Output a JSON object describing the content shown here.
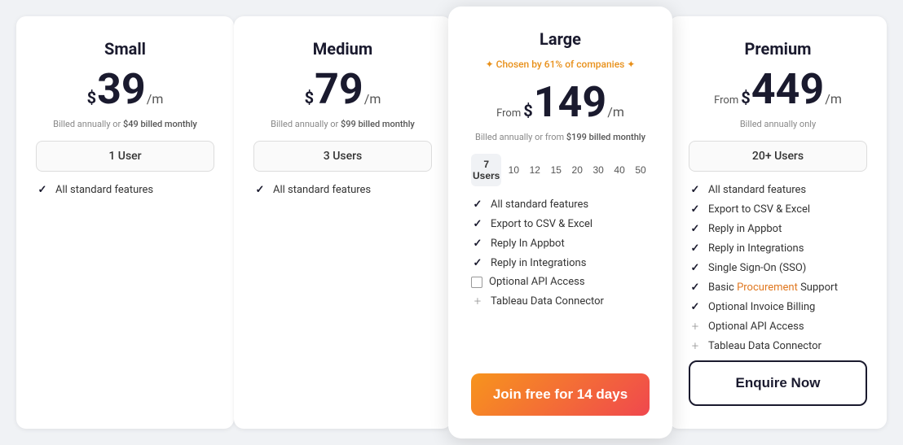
{
  "plans": [
    {
      "id": "small",
      "name": "Small",
      "featured": false,
      "badge": null,
      "price_from": false,
      "price": "39",
      "period": "/m",
      "billing": "Billed annually or",
      "billing_alt": "$49 billed monthly",
      "user_label": "1 User",
      "features": [
        {
          "icon": "check",
          "text": "All standard features"
        }
      ],
      "cta": null
    },
    {
      "id": "medium",
      "name": "Medium",
      "featured": false,
      "badge": null,
      "price_from": false,
      "price": "79",
      "period": "/m",
      "billing": "Billed annually or",
      "billing_alt": "$99 billed monthly",
      "user_label": "3 Users",
      "features": [
        {
          "icon": "check",
          "text": "All standard features"
        }
      ],
      "cta": null
    },
    {
      "id": "large",
      "name": "Large",
      "featured": true,
      "badge": "✦ Chosen by 61% of companies ✦",
      "price_from": true,
      "price": "149",
      "period": "/m",
      "billing": "Billed annually or from",
      "billing_alt": "$199 billed monthly",
      "user_tabs": [
        "7 Users",
        "10",
        "12",
        "15",
        "20",
        "30",
        "40",
        "50"
      ],
      "active_tab": 0,
      "features": [
        {
          "icon": "check",
          "text": "All standard features"
        },
        {
          "icon": "check",
          "text": "Export to CSV & Excel"
        },
        {
          "icon": "check",
          "text": "Reply In Appbot"
        },
        {
          "icon": "check",
          "text": "Reply in Integrations"
        },
        {
          "icon": "checkbox",
          "text": "Optional API Access"
        },
        {
          "icon": "plus",
          "text": "Tableau Data Connector"
        }
      ],
      "cta": "Join free for 14 days"
    },
    {
      "id": "premium",
      "name": "Premium",
      "featured": false,
      "badge": null,
      "price_from": true,
      "price": "449",
      "period": "/m",
      "billing": "Billed annually only",
      "billing_alt": null,
      "user_label": "20+ Users",
      "features": [
        {
          "icon": "check",
          "text": "All standard features"
        },
        {
          "icon": "check",
          "text": "Export to CSV & Excel"
        },
        {
          "icon": "check",
          "text": "Reply in Appbot"
        },
        {
          "icon": "check",
          "text": "Reply in Integrations"
        },
        {
          "icon": "check",
          "text": "Single Sign-On (SSO)"
        },
        {
          "icon": "check",
          "text": "Basic Procurement Support",
          "link_word": "Procurement"
        },
        {
          "icon": "check",
          "text": "Optional Invoice Billing"
        },
        {
          "icon": "plus",
          "text": "Optional API Access"
        },
        {
          "icon": "plus",
          "text": "Tableau Data Connector"
        }
      ],
      "cta": "Enquire Now"
    }
  ]
}
